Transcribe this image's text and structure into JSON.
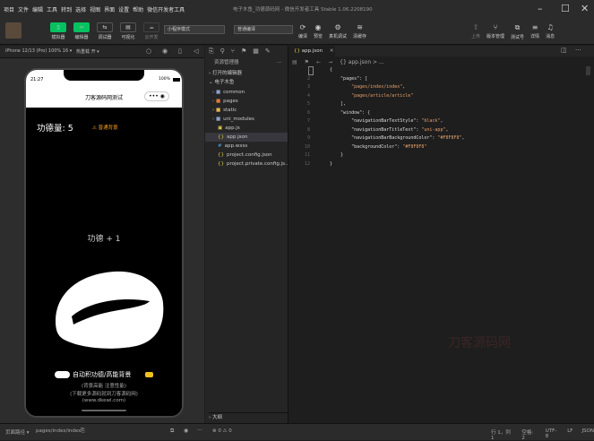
{
  "menubar": {
    "items": [
      "项目",
      "文件",
      "编辑",
      "工具",
      "转到",
      "选择",
      "视图",
      "界面",
      "设置",
      "帮助",
      "微信开发者工具"
    ],
    "window_title": "电子木鱼_功德源码网 - 微信开发者工具 Stable 1.06.2208190"
  },
  "toolbar": {
    "left_buttons": [
      "模拟器",
      "编辑器",
      "调试器",
      "可视化",
      "云开发"
    ],
    "mode_select": "小程序模式",
    "compile_select": "普通编译",
    "mid_buttons": [
      "编译",
      "预览",
      "真机调试",
      "清缓存"
    ],
    "right_buttons": [
      "上传",
      "版本管理",
      "测试号",
      "详情",
      "消息"
    ],
    "accent": "#07c160"
  },
  "simulator": {
    "device": "iPhone 12/13 (Pro) 100% 16 ▾",
    "hotreload": "热重载 开 ▾",
    "status_time": "21:27",
    "battery": "100%",
    "nav_title": "刀客源码网测试",
    "merit_label": "功德量: 5",
    "mode_badge": "⚠ 普通背景",
    "merit_float": "功德 + 1",
    "toggle_label": "自动积功德/高能背景",
    "hint_line1": "(背景高能 注意性能)",
    "hint_line2": "(下载更多源码就到刀客源码网)",
    "hint_line3": "(www.dkewl.com)",
    "badge_color": "#f0a020"
  },
  "explorer": {
    "header": "资源管理器",
    "section_open": "打开的编辑器",
    "section_project": "电子木鱼",
    "items": [
      {
        "name": "common",
        "type": "folder",
        "color": "#8da0c7"
      },
      {
        "name": "pages",
        "type": "folder",
        "color": "#e07b39"
      },
      {
        "name": "static",
        "type": "folder",
        "color": "#e0b84a"
      },
      {
        "name": "uni_modules",
        "type": "folder",
        "color": "#8da0c7"
      },
      {
        "name": "app.js",
        "type": "file",
        "color": "#e0c74a"
      },
      {
        "name": "app.json",
        "type": "file",
        "color": "#e0c74a"
      },
      {
        "name": "app.wxss",
        "type": "file",
        "color": "#4aa0e0"
      },
      {
        "name": "project.config.json",
        "type": "file",
        "color": "#e0c74a"
      },
      {
        "name": "project.private.config.js...",
        "type": "file",
        "color": "#e0c74a"
      }
    ],
    "outline": "大纲",
    "problems": "⊗ 0 ⚠ 0"
  },
  "editor": {
    "tab": "app.json",
    "breadcrumb": "{} app.json > ...",
    "lines": [
      {
        "n": "1",
        "text": "{"
      },
      {
        "n": "2",
        "text": "    \"pages\": ["
      },
      {
        "n": "3",
        "text": "        \"pages/index/index\","
      },
      {
        "n": "4",
        "text": "        \"pages/article/article\""
      },
      {
        "n": "5",
        "text": "    ],"
      },
      {
        "n": "6",
        "text": "    \"window\": {"
      },
      {
        "n": "7",
        "text": "        \"navigationBarTextStyle\": \"black\","
      },
      {
        "n": "8",
        "text": "        \"navigationBarTitleText\": \"uni-app\","
      },
      {
        "n": "9",
        "text": "        \"navigationBarBackgroundColor\": \"#F8F8F8\","
      },
      {
        "n": "10",
        "text": "        \"backgroundColor\": \"#F8F8F8\""
      },
      {
        "n": "11",
        "text": "    }"
      },
      {
        "n": "12",
        "text": "}"
      }
    ],
    "watermark": "刀客源码网"
  },
  "statusbar": {
    "path_label": "页面路径 ▾",
    "path": "pages/index/index",
    "right": [
      "行 1，列 1",
      "空格: 2",
      "UTF-8",
      "LF",
      "JSON"
    ]
  }
}
